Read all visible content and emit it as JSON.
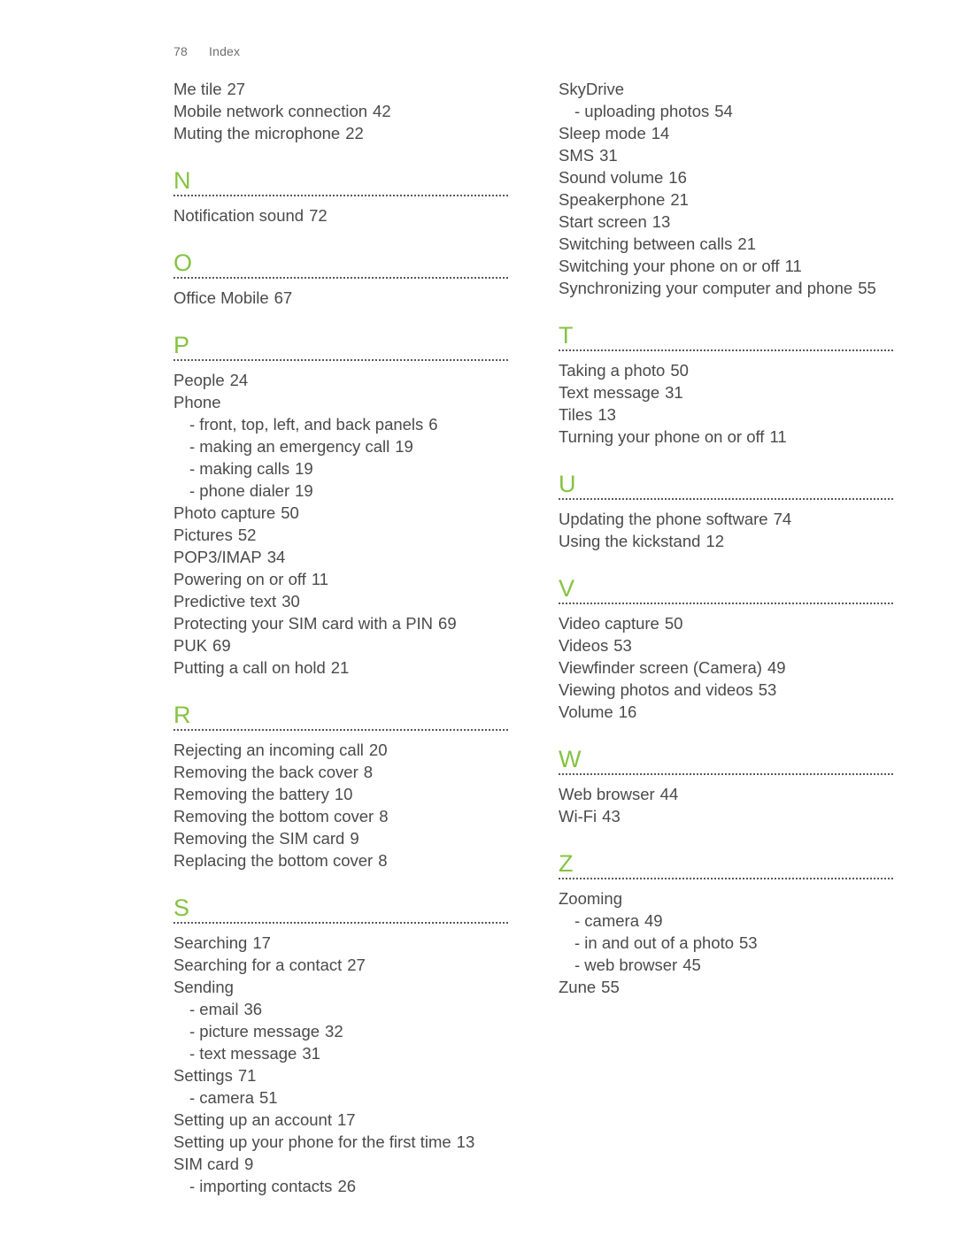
{
  "header": {
    "folio": "78",
    "label": "Index"
  },
  "theme": {
    "accent_green": "#85c341",
    "body_text": "#4a4a4a",
    "rule_color": "#5a5a5a"
  },
  "columns": [
    {
      "name": "left",
      "lead_entries": [
        {
          "term": "Me tile",
          "page": "27",
          "sub": false
        },
        {
          "term": "Mobile network connection",
          "page": "42",
          "sub": false
        },
        {
          "term": "Muting the microphone",
          "page": "22",
          "sub": false
        }
      ],
      "sections": [
        {
          "letter": "N",
          "entries": [
            {
              "term": "Notification sound",
              "page": "72",
              "sub": false
            }
          ]
        },
        {
          "letter": "O",
          "entries": [
            {
              "term": "Office Mobile",
              "page": "67",
              "sub": false
            }
          ]
        },
        {
          "letter": "P",
          "entries": [
            {
              "term": "People",
              "page": "24",
              "sub": false
            },
            {
              "term": "Phone",
              "page": "",
              "sub": false
            },
            {
              "term": "- front, top, left, and back panels",
              "page": "6",
              "sub": true
            },
            {
              "term": "- making an emergency call",
              "page": "19",
              "sub": true
            },
            {
              "term": "- making calls",
              "page": "19",
              "sub": true
            },
            {
              "term": "- phone dialer",
              "page": "19",
              "sub": true
            },
            {
              "term": "Photo capture",
              "page": "50",
              "sub": false
            },
            {
              "term": "Pictures",
              "page": "52",
              "sub": false
            },
            {
              "term": "POP3/IMAP",
              "page": "34",
              "sub": false
            },
            {
              "term": "Powering on or off",
              "page": "11",
              "sub": false
            },
            {
              "term": "Predictive text",
              "page": "30",
              "sub": false
            },
            {
              "term": "Protecting your SIM card with a PIN",
              "page": "69",
              "sub": false
            },
            {
              "term": "PUK",
              "page": "69",
              "sub": false
            },
            {
              "term": "Putting a call on hold",
              "page": "21",
              "sub": false
            }
          ]
        },
        {
          "letter": "R",
          "entries": [
            {
              "term": "Rejecting an incoming call",
              "page": "20",
              "sub": false
            },
            {
              "term": "Removing the back cover",
              "page": "8",
              "sub": false
            },
            {
              "term": "Removing the battery",
              "page": "10",
              "sub": false
            },
            {
              "term": "Removing the bottom cover",
              "page": "8",
              "sub": false
            },
            {
              "term": "Removing the SIM card",
              "page": "9",
              "sub": false
            },
            {
              "term": "Replacing the bottom cover",
              "page": "8",
              "sub": false
            }
          ]
        },
        {
          "letter": "S",
          "entries": [
            {
              "term": "Searching",
              "page": "17",
              "sub": false
            },
            {
              "term": "Searching for a contact",
              "page": "27",
              "sub": false
            },
            {
              "term": "Sending",
              "page": "",
              "sub": false
            },
            {
              "term": "- email",
              "page": "36",
              "sub": true
            },
            {
              "term": "- picture message",
              "page": "32",
              "sub": true
            },
            {
              "term": "- text message",
              "page": "31",
              "sub": true
            },
            {
              "term": "Settings",
              "page": "71",
              "sub": false
            },
            {
              "term": "- camera",
              "page": "51",
              "sub": true
            },
            {
              "term": "Setting up an account",
              "page": "17",
              "sub": false
            },
            {
              "term": "Setting up your phone for the first time",
              "page": "13",
              "sub": false
            },
            {
              "term": "SIM card",
              "page": "9",
              "sub": false
            },
            {
              "term": "- importing contacts",
              "page": "26",
              "sub": true
            }
          ]
        }
      ]
    },
    {
      "name": "right",
      "lead_entries": [
        {
          "term": "SkyDrive",
          "page": "",
          "sub": false
        },
        {
          "term": "- uploading photos",
          "page": "54",
          "sub": true
        },
        {
          "term": "Sleep mode",
          "page": "14",
          "sub": false
        },
        {
          "term": "SMS",
          "page": "31",
          "sub": false
        },
        {
          "term": "Sound volume",
          "page": "16",
          "sub": false
        },
        {
          "term": "Speakerphone",
          "page": "21",
          "sub": false
        },
        {
          "term": "Start screen",
          "page": "13",
          "sub": false
        },
        {
          "term": "Switching between calls",
          "page": "21",
          "sub": false
        },
        {
          "term": "Switching your phone on or off",
          "page": "11",
          "sub": false
        },
        {
          "term": "Synchronizing your computer and phone",
          "page": "55",
          "sub": false
        }
      ],
      "sections": [
        {
          "letter": "T",
          "entries": [
            {
              "term": "Taking a photo",
              "page": "50",
              "sub": false
            },
            {
              "term": "Text message",
              "page": "31",
              "sub": false
            },
            {
              "term": "Tiles",
              "page": "13",
              "sub": false
            },
            {
              "term": "Turning your phone on or off",
              "page": "11",
              "sub": false
            }
          ]
        },
        {
          "letter": "U",
          "entries": [
            {
              "term": "Updating the phone software",
              "page": "74",
              "sub": false
            },
            {
              "term": "Using the kickstand",
              "page": "12",
              "sub": false
            }
          ]
        },
        {
          "letter": "V",
          "entries": [
            {
              "term": "Video capture",
              "page": "50",
              "sub": false
            },
            {
              "term": "Videos",
              "page": "53",
              "sub": false
            },
            {
              "term": "Viewfinder screen (Camera)",
              "page": "49",
              "sub": false
            },
            {
              "term": "Viewing photos and videos",
              "page": "53",
              "sub": false
            },
            {
              "term": "Volume",
              "page": "16",
              "sub": false
            }
          ]
        },
        {
          "letter": "W",
          "entries": [
            {
              "term": "Web browser",
              "page": "44",
              "sub": false
            },
            {
              "term": "Wi-Fi",
              "page": "43",
              "sub": false
            }
          ]
        },
        {
          "letter": "Z",
          "entries": [
            {
              "term": "Zooming",
              "page": "",
              "sub": false
            },
            {
              "term": "- camera",
              "page": "49",
              "sub": true
            },
            {
              "term": "- in and out of a photo",
              "page": "53",
              "sub": true
            },
            {
              "term": "- web browser",
              "page": "45",
              "sub": true
            },
            {
              "term": "Zune",
              "page": "55",
              "sub": false
            }
          ]
        }
      ]
    }
  ]
}
